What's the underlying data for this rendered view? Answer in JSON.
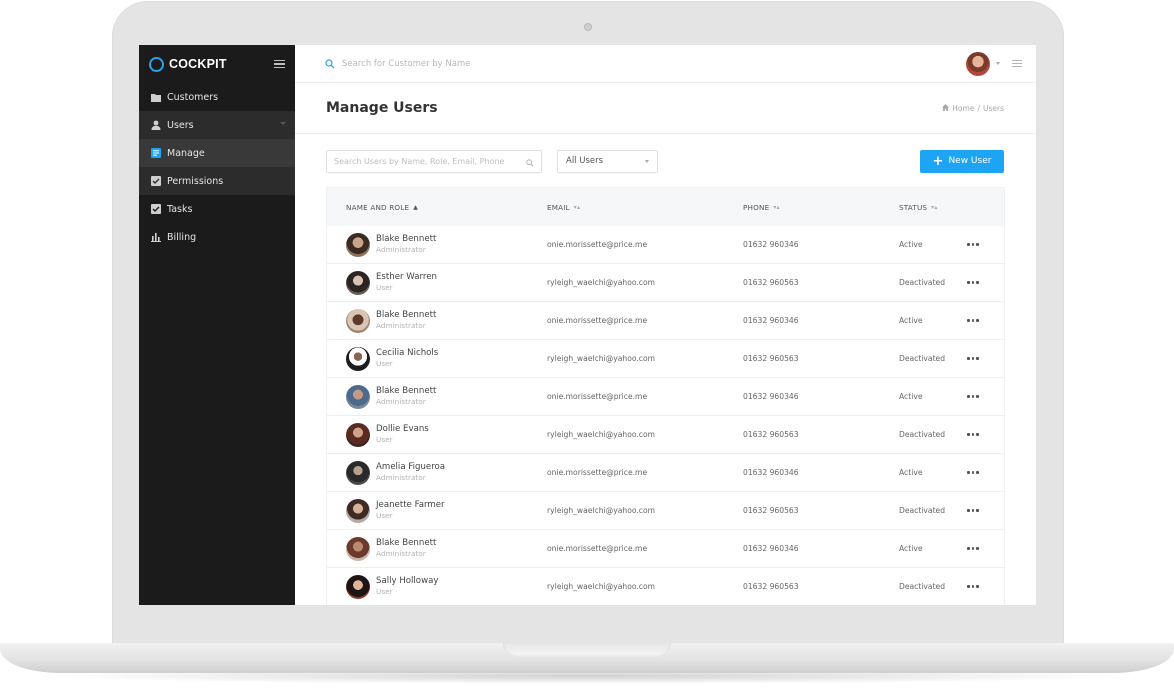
{
  "app": {
    "brand": "COCKPIT",
    "accent_color": "#1ea4f5",
    "sidebar_bg": "#1c1b1c"
  },
  "sidebar": {
    "items": [
      {
        "label": "Customers",
        "icon": "folder-icon"
      },
      {
        "label": "Users",
        "icon": "user-icon",
        "expanded": true
      },
      {
        "label": "Manage",
        "icon": "list-icon",
        "active": true
      },
      {
        "label": "Permissions",
        "icon": "checkbox-icon"
      },
      {
        "label": "Tasks",
        "icon": "checkbox-icon"
      },
      {
        "label": "Billing",
        "icon": "bar-chart-icon"
      }
    ]
  },
  "topbar": {
    "search_placeholder": "Search for Customer by Name"
  },
  "page": {
    "title": "Manage Users",
    "breadcrumb": [
      "Home",
      "Users"
    ],
    "breadcrumb_sep": "/"
  },
  "filters": {
    "search_placeholder": "Search Users by Name, Role, Email, Phone",
    "select_value": "All Users",
    "new_user_label": "New User"
  },
  "table": {
    "columns": [
      {
        "label": "NAME AND ROLE",
        "sort": "▲"
      },
      {
        "label": "EMAIL",
        "sort": "▾▴"
      },
      {
        "label": "PHONE",
        "sort": "▾▴"
      },
      {
        "label": "STATUS",
        "sort": "▾▴"
      }
    ],
    "rows": [
      {
        "name": "Blake Bennett",
        "role": "Administrator",
        "email": "onie.morissette@price.me",
        "phone": "01632 960346",
        "status": "Active"
      },
      {
        "name": "Esther Warren",
        "role": "User",
        "email": "ryleigh_waelchi@yahoo.com",
        "phone": "01632 960563",
        "status": "Deactivated"
      },
      {
        "name": "Blake Bennett",
        "role": "Administrator",
        "email": "onie.morissette@price.me",
        "phone": "01632 960346",
        "status": "Active"
      },
      {
        "name": "Cecilia Nichols",
        "role": "User",
        "email": "ryleigh_waelchi@yahoo.com",
        "phone": "01632 960563",
        "status": "Deactivated"
      },
      {
        "name": "Blake Bennett",
        "role": "Administrator",
        "email": "onie.morissette@price.me",
        "phone": "01632 960346",
        "status": "Active"
      },
      {
        "name": "Dollie Evans",
        "role": "User",
        "email": "ryleigh_waelchi@yahoo.com",
        "phone": "01632 960563",
        "status": "Deactivated"
      },
      {
        "name": "Amelia Figueroa",
        "role": "Administrator",
        "email": "onie.morissette@price.me",
        "phone": "01632 960346",
        "status": "Active"
      },
      {
        "name": "Jeanette Farmer",
        "role": "User",
        "email": "ryleigh_waelchi@yahoo.com",
        "phone": "01632 960563",
        "status": "Deactivated"
      },
      {
        "name": "Blake Bennett",
        "role": "Administrator",
        "email": "onie.morissette@price.me",
        "phone": "01632 960346",
        "status": "Active"
      },
      {
        "name": "Sally Holloway",
        "role": "User",
        "email": "ryleigh_waelchi@yahoo.com",
        "phone": "01632 960563",
        "status": "Deactivated"
      }
    ]
  }
}
